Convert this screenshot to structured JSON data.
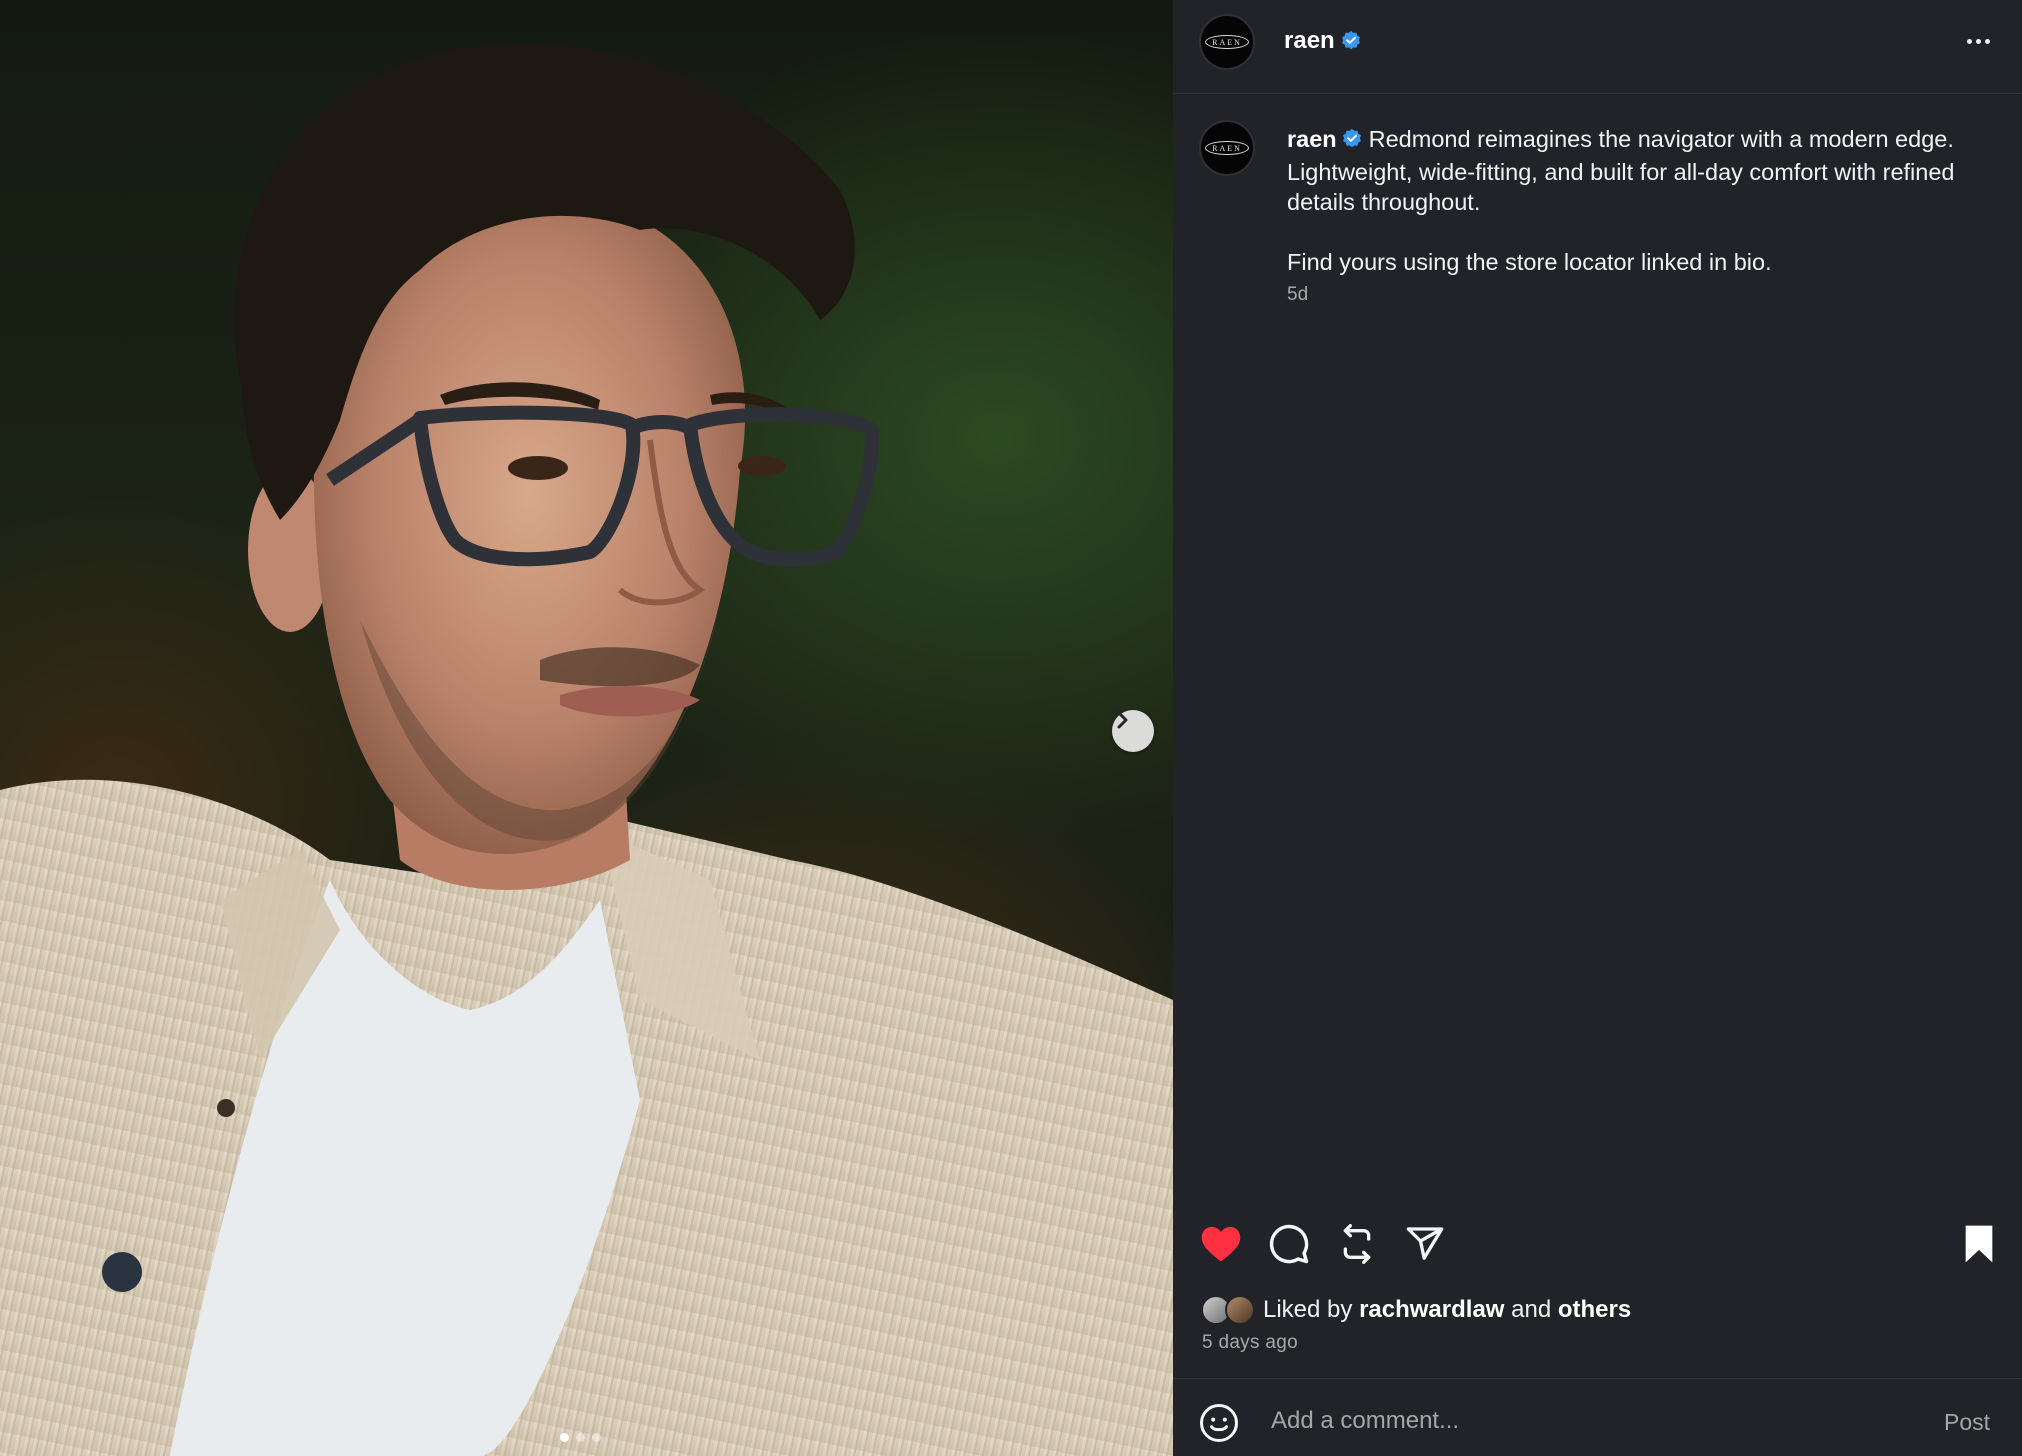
{
  "post": {
    "username": "raen",
    "avatar_logo_text": "RAEN",
    "caption_line1": "Redmond reimagines the navigator with a modern edge. Lightweight, wide-fitting, and built for all-day comfort with refined details throughout.",
    "caption_line2": "Find yours using the store locator linked in bio.",
    "caption_time": "5d",
    "liked_by_prefix": "Liked by",
    "liked_by_user": "rachwardlaw",
    "liked_by_and": "and",
    "liked_by_others": "others",
    "date": "5 days ago"
  },
  "comment": {
    "placeholder": "Add a comment...",
    "post_label": "Post"
  },
  "carousel": {
    "slide_count": 3,
    "active_index": 0
  },
  "icons": {
    "like": "heart-icon",
    "comment": "comment-icon",
    "repost": "repost-icon",
    "share": "share-icon",
    "save": "bookmark-icon",
    "more": "more-icon",
    "next": "chevron-right-icon",
    "emoji": "emoji-icon",
    "verified": "verified-badge-icon"
  },
  "colors": {
    "panel_bg": "#212328",
    "liked": "#ff3040",
    "verified": "#3897f0",
    "secondary_text": "#a8a8a8"
  }
}
